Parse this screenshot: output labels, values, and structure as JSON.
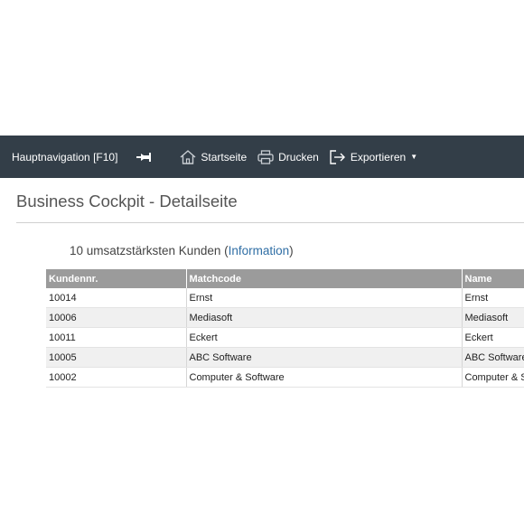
{
  "toolbar": {
    "nav_label": "Hauptnavigation [F10]",
    "home_label": "Startseite",
    "print_label": "Drucken",
    "export_label": "Exportieren",
    "background": "#333e48"
  },
  "page": {
    "title": "Business Cockpit - Detailseite",
    "subtitle_text": "10 umsatzstärksten Kunden",
    "subtitle_paren_open": " (",
    "subtitle_link": "Information",
    "subtitle_paren_close": ")"
  },
  "table": {
    "headers": [
      "Kundennr.",
      "Matchcode",
      "Name"
    ],
    "rows": [
      [
        "10014",
        "Ernst",
        "Ernst"
      ],
      [
        "10006",
        "Mediasoft",
        "Mediasoft"
      ],
      [
        "10011",
        "Eckert",
        "Eckert"
      ],
      [
        "10005",
        "ABC Software",
        "ABC Software"
      ],
      [
        "10002",
        "Computer & Software",
        "Computer & Software"
      ]
    ]
  },
  "icons": {
    "pin": "pin-icon",
    "home": "home-icon",
    "print": "printer-icon",
    "export": "export-icon",
    "caret": "caret-down-icon"
  }
}
